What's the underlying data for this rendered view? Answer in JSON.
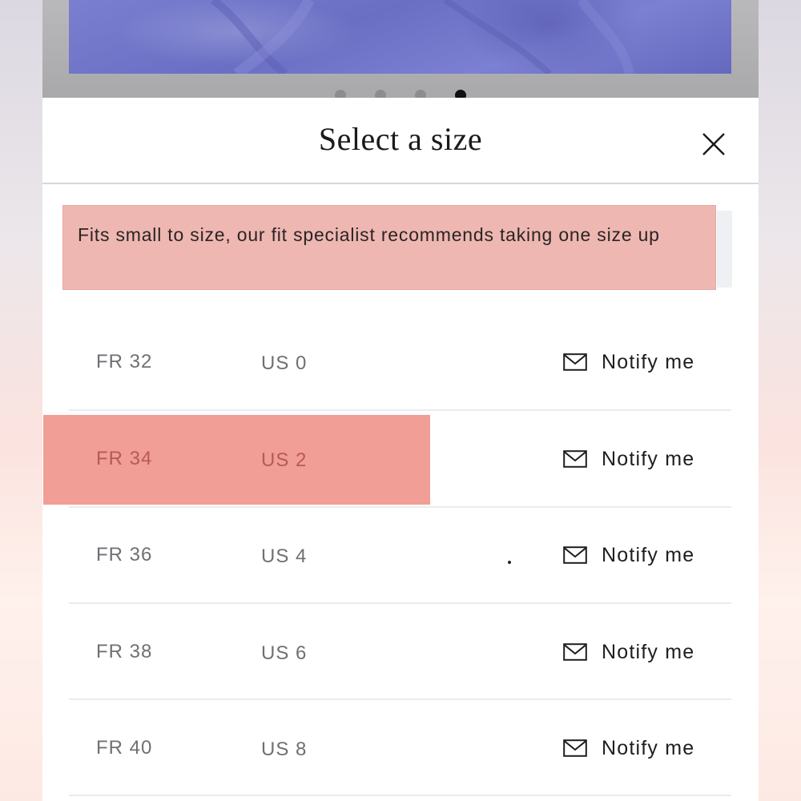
{
  "gallery": {
    "dot_count": 4,
    "active_dot": 3
  },
  "sheet": {
    "title": "Select a size",
    "close_icon": "close-icon",
    "fit_notice": "Fits small to size, our fit specialist recommends taking one size up"
  },
  "sizes": [
    {
      "fr": "FR 32",
      "us": "US 0",
      "action": "Notify me",
      "icon": "mail-icon",
      "highlighted": false
    },
    {
      "fr": "FR 34",
      "us": "US 2",
      "action": "Notify me",
      "icon": "mail-icon",
      "highlighted": true
    },
    {
      "fr": "FR 36",
      "us": "US 4",
      "action": "Notify me",
      "icon": "mail-icon",
      "highlighted": false
    },
    {
      "fr": "FR 38",
      "us": "US 6",
      "action": "Notify me",
      "icon": "mail-icon",
      "highlighted": false
    },
    {
      "fr": "FR 40",
      "us": "US 8",
      "action": "Notify me",
      "icon": "mail-icon",
      "highlighted": false
    }
  ],
  "colors": {
    "notice_bg": "#eeb7b2",
    "highlight": "#f09e96",
    "product_fabric": "#7a7fd0"
  }
}
